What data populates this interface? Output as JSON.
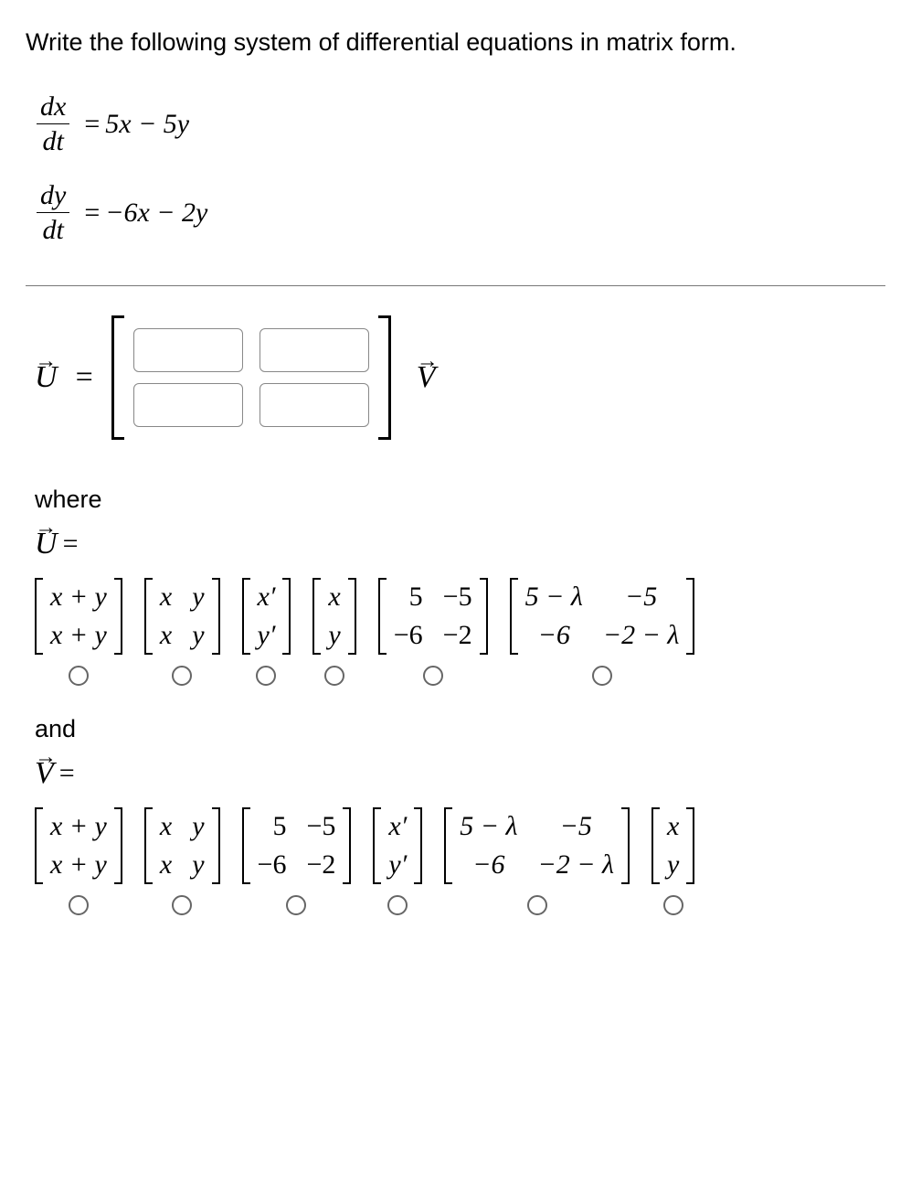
{
  "prompt": "Write the following system of differential equations in matrix form.",
  "equations": {
    "eq1": {
      "lhs_num": "dx",
      "lhs_den": "dt",
      "rhs": "5x − 5y"
    },
    "eq2": {
      "lhs_num": "dy",
      "lhs_den": "dt",
      "rhs": "−6x − 2y"
    }
  },
  "uv_row": {
    "U_symbol": "U",
    "V_symbol": "V",
    "equals": "=",
    "arrow": "→",
    "matrix_inputs": [
      "",
      "",
      "",
      ""
    ]
  },
  "where_label": "where",
  "and_label": "and",
  "U_line": {
    "symbol": "U",
    "equals": "="
  },
  "V_line": {
    "symbol": "V",
    "equals": "="
  },
  "U_choices": [
    {
      "rows": [
        [
          "x + y"
        ],
        [
          "x + y"
        ]
      ],
      "cols": 1
    },
    {
      "rows": [
        [
          "x",
          "y"
        ],
        [
          "x",
          "y"
        ]
      ],
      "cols": 2
    },
    {
      "rows": [
        [
          "x′"
        ],
        [
          "y′"
        ]
      ],
      "cols": 1
    },
    {
      "rows": [
        [
          "x"
        ],
        [
          "y"
        ]
      ],
      "cols": 1
    },
    {
      "rows": [
        [
          "5",
          "−5"
        ],
        [
          "−6",
          "−2"
        ]
      ],
      "cols": 2,
      "numeric": true
    },
    {
      "rows": [
        [
          "5 − λ",
          "−5"
        ],
        [
          "−6",
          "−2 − λ"
        ]
      ],
      "cols": 2
    }
  ],
  "V_choices": [
    {
      "rows": [
        [
          "x + y"
        ],
        [
          "x + y"
        ]
      ],
      "cols": 1
    },
    {
      "rows": [
        [
          "x",
          "y"
        ],
        [
          "x",
          "y"
        ]
      ],
      "cols": 2
    },
    {
      "rows": [
        [
          "5",
          "−5"
        ],
        [
          "−6",
          "−2"
        ]
      ],
      "cols": 2,
      "numeric": true
    },
    {
      "rows": [
        [
          "x′"
        ],
        [
          "y′"
        ]
      ],
      "cols": 1
    },
    {
      "rows": [
        [
          "5 − λ",
          "−5"
        ],
        [
          "−6",
          "−2 − λ"
        ]
      ],
      "cols": 2
    },
    {
      "rows": [
        [
          "x"
        ],
        [
          "y"
        ]
      ],
      "cols": 1
    }
  ]
}
